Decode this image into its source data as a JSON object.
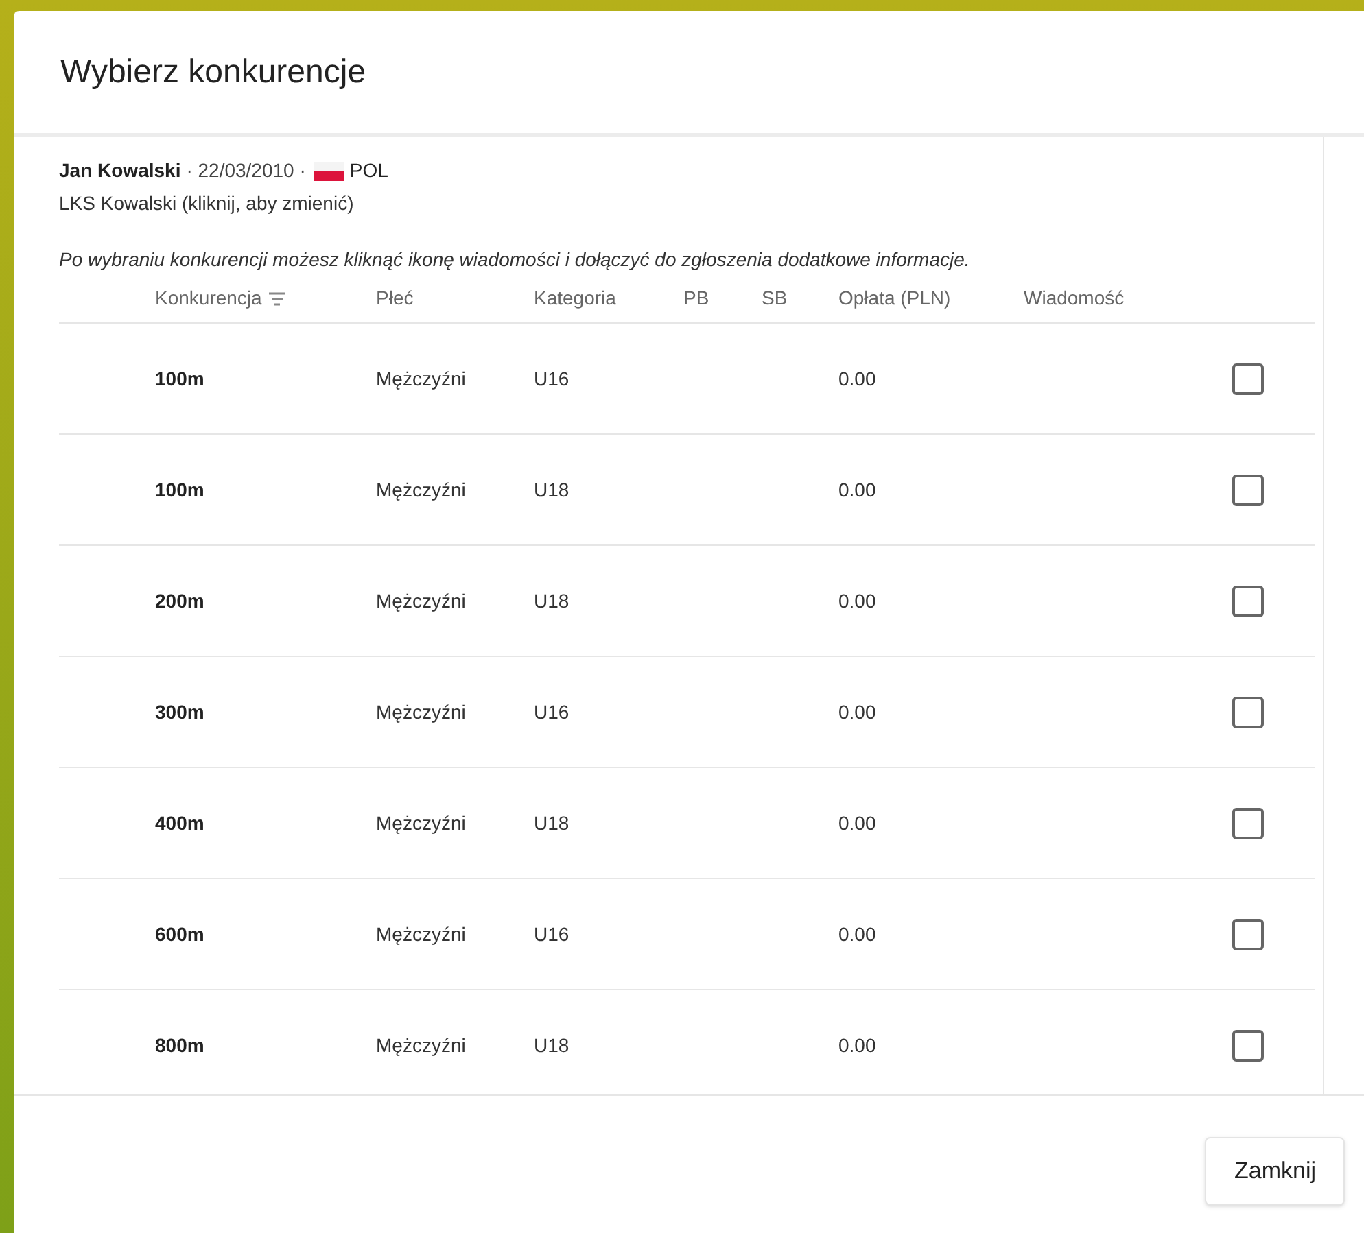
{
  "dialog": {
    "title": "Wybierz konkurencje",
    "athlete": {
      "name": "Jan Kowalski",
      "birth_date": "· 22/03/2010 ·",
      "country": "POL",
      "club": "LKS Kowalski (kliknij, aby zmienić)"
    },
    "hint": "Po wybraniu konkurencji możesz kliknąć ikonę wiadomości i dołączyć do zgłoszenia dodatkowe informacje.",
    "table": {
      "columns": [
        "Konkurencja",
        "Płeć",
        "Kategoria",
        "PB",
        "SB",
        "Opłata (PLN)",
        "Wiadomość"
      ],
      "rows": [
        {
          "event": "100m",
          "sex": "Mężczyźni",
          "category": "U16",
          "fee": "0.00",
          "checked": false
        },
        {
          "event": "100m",
          "sex": "Mężczyźni",
          "category": "U18",
          "fee": "0.00",
          "checked": false
        },
        {
          "event": "200m",
          "sex": "Mężczyźni",
          "category": "U18",
          "fee": "0.00",
          "checked": false
        },
        {
          "event": "300m",
          "sex": "Mężczyźni",
          "category": "U16",
          "fee": "0.00",
          "checked": false
        },
        {
          "event": "400m",
          "sex": "Mężczyźni",
          "category": "U18",
          "fee": "0.00",
          "checked": false
        },
        {
          "event": "600m",
          "sex": "Mężczyźni",
          "category": "U16",
          "fee": "0.00",
          "checked": false
        },
        {
          "event": "800m",
          "sex": "Mężczyźni",
          "category": "U18",
          "fee": "0.00",
          "checked": false
        }
      ]
    },
    "buttons": [
      "Zamknij"
    ]
  }
}
